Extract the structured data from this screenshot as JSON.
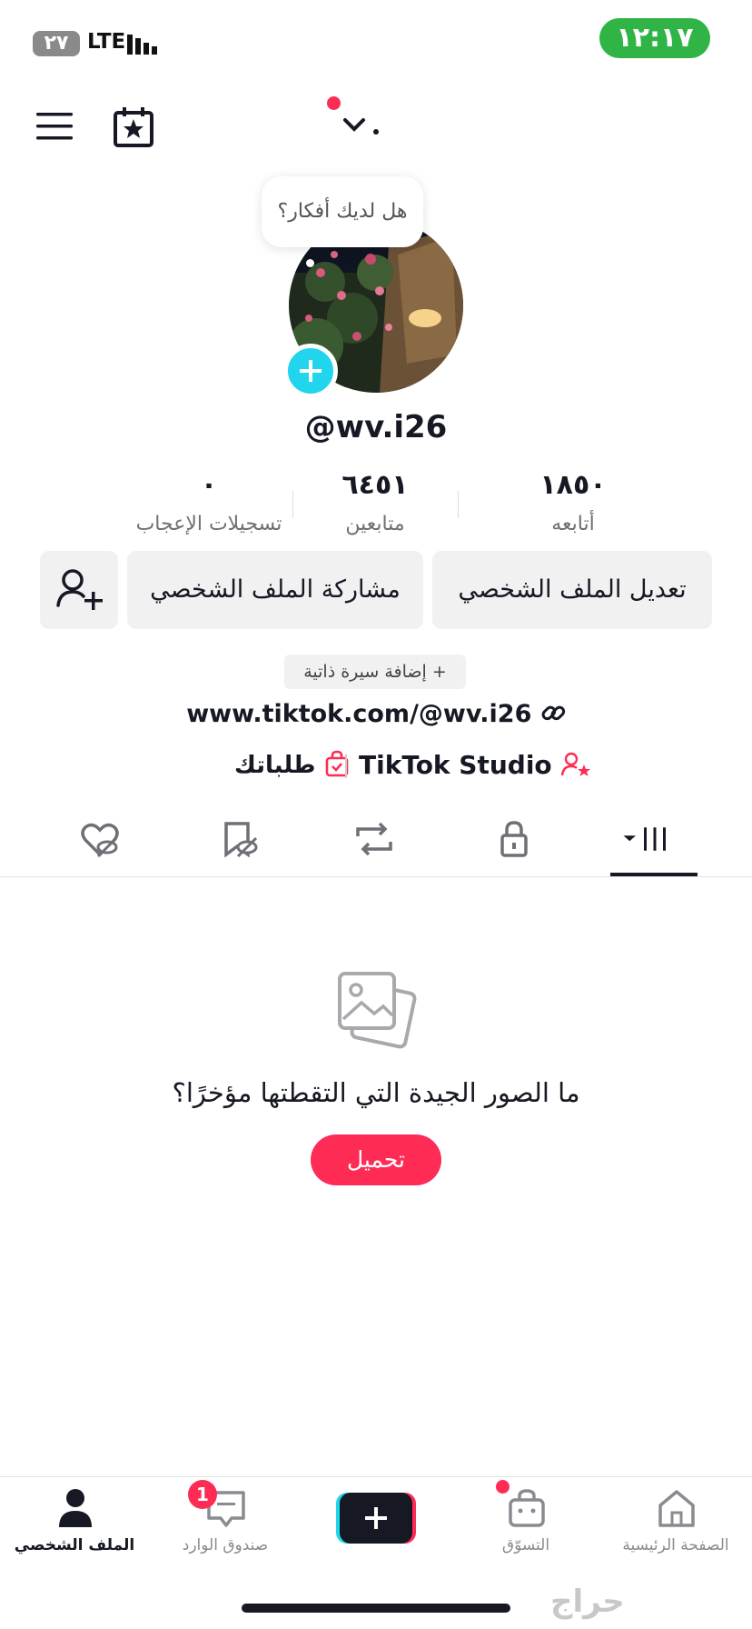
{
  "status_bar": {
    "battery": "٢٧",
    "network": "LTE",
    "time": "١٢:١٧"
  },
  "header": {
    "menu_icon": "hamburger-icon",
    "calendar_icon": "calendar-star-icon",
    "account_switch_icon": "chevron-down-icon"
  },
  "profile": {
    "bubble_text": "هل لديك أفكار؟",
    "username": "@wv.i26",
    "stats": [
      {
        "value": "١٨٥٠",
        "label": "أتابعه"
      },
      {
        "value": "٦٤٥١",
        "label": "متابعين"
      },
      {
        "value": "٠",
        "label": "تسجيلات الإعجاب"
      }
    ],
    "buttons": {
      "edit": "تعديل الملف الشخصي",
      "share": "مشاركة الملف الشخصي"
    },
    "add_bio": "+ إضافة سيرة ذاتية",
    "link": "www.tiktok.com/@wv.i26",
    "studio": "TikTok Studio",
    "orders": "طلباتك"
  },
  "tabs": [
    "videos-grid",
    "private-lock",
    "reposts",
    "favorites",
    "liked"
  ],
  "empty_state": {
    "title": "ما الصور الجيدة التي التقطتها مؤخرًا؟",
    "button": "تحميل"
  },
  "bottom_nav": [
    {
      "label": "الصفحة الرئيسية"
    },
    {
      "label": "التسوّق"
    },
    {
      "label": ""
    },
    {
      "label": "صندوق الوارد",
      "badge": "1"
    },
    {
      "label": "الملف الشخصي"
    }
  ],
  "watermark": "حراج",
  "colors": {
    "accent": "#fe2c55",
    "cyan": "#20d5ec",
    "clock_bg": "#2fb445"
  }
}
